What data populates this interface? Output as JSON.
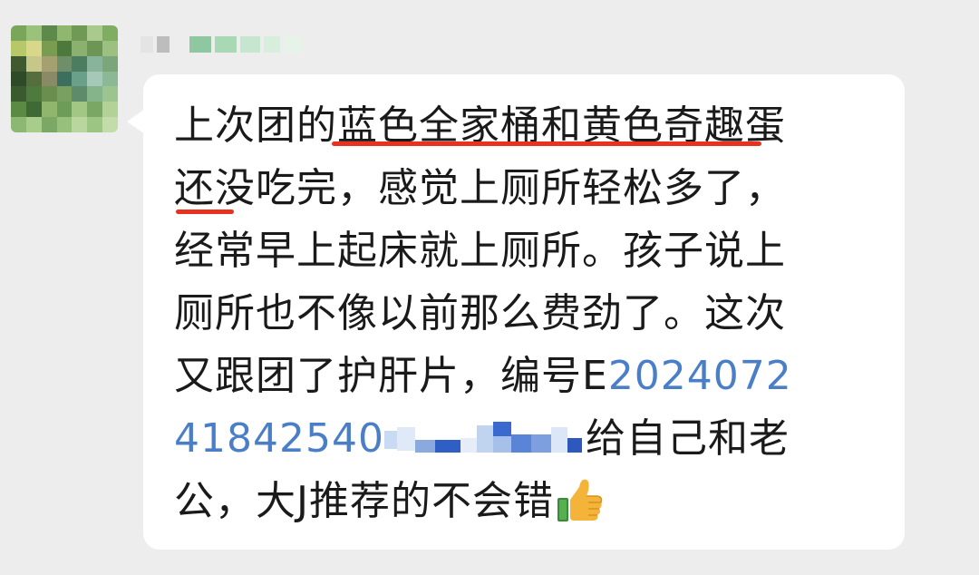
{
  "message": {
    "part_before_highlight": "上次团的",
    "highlight": "蓝色全家桶和黄色奇趣蛋",
    "part_after_highlight": "还没吃完，感觉上厕所轻松多了，经常早上起床就上厕所。孩子说上厕所也不像以前那么费劲了。这次又跟团了护肝片，编号",
    "order_prefix": "E",
    "order_number": "202407241842540",
    "part_after_order": "给自己和老公，大J推荐的不会错"
  },
  "icons": {
    "emoji": "thumbs-up-icon"
  },
  "colors": {
    "background": "#ededed",
    "bubble": "#ffffff",
    "text": "#1a1a1a",
    "link": "#4a7fc7",
    "underline": "#e8311f"
  }
}
